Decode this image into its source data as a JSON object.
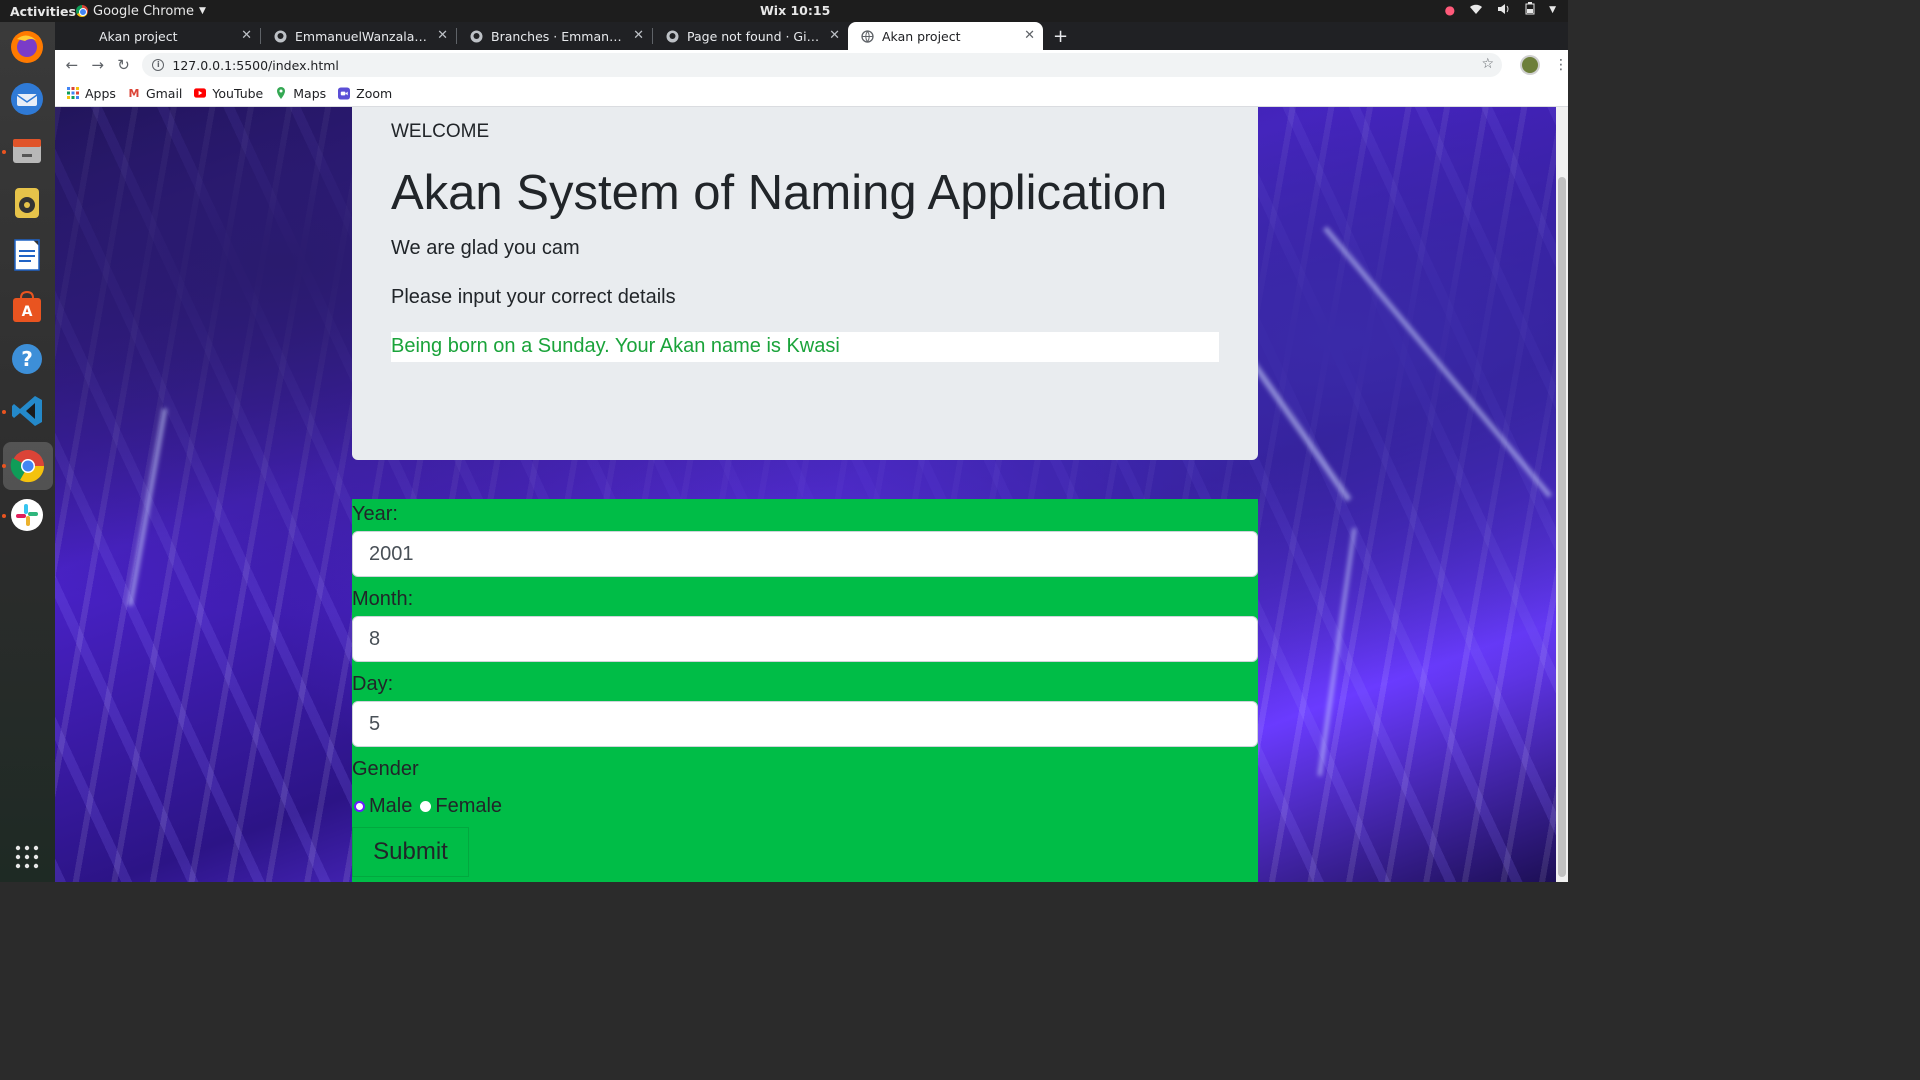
{
  "system": {
    "activities": "Activities",
    "app_name": "Google Chrome",
    "clock": "Wix 10:15"
  },
  "tabs": [
    {
      "title": "Akan project",
      "icon": "blank-icon",
      "active": false
    },
    {
      "title": "EmmanuelWanzala/week",
      "icon": "github-icon",
      "active": false
    },
    {
      "title": "Branches · EmmanuelWar",
      "icon": "github-icon",
      "active": false
    },
    {
      "title": "Page not found · GitHub",
      "icon": "github-icon",
      "active": false
    },
    {
      "title": "Akan project",
      "icon": "globe-icon",
      "active": true
    }
  ],
  "address": {
    "url": "127.0.0.1:5500/index.html"
  },
  "bookmarks": [
    {
      "label": "Apps",
      "icon": "apps-grid-icon"
    },
    {
      "label": "Gmail",
      "icon": "gmail-icon"
    },
    {
      "label": "YouTube",
      "icon": "youtube-icon"
    },
    {
      "label": "Maps",
      "icon": "maps-icon"
    },
    {
      "label": "Zoom",
      "icon": "zoom-icon"
    }
  ],
  "card": {
    "welcome": "WELCOME",
    "title": "Akan System of Naming Application",
    "lead1": "We are glad you cam",
    "lead2": "Please input your correct details",
    "result": "Being born on a Sunday. Your Akan name is Kwasi"
  },
  "form": {
    "year_label": "Year:",
    "year_value": "2001",
    "month_label": "Month:",
    "month_value": "8",
    "day_label": "Day:",
    "day_value": "5",
    "gender_label": "Gender",
    "male_label": "Male",
    "female_label": "Female",
    "selected_gender": "Male",
    "submit_label": "Submit"
  },
  "colors": {
    "form_bg": "#00bd47",
    "card_bg": "#e9ecef",
    "result_text": "#1aa33a"
  }
}
